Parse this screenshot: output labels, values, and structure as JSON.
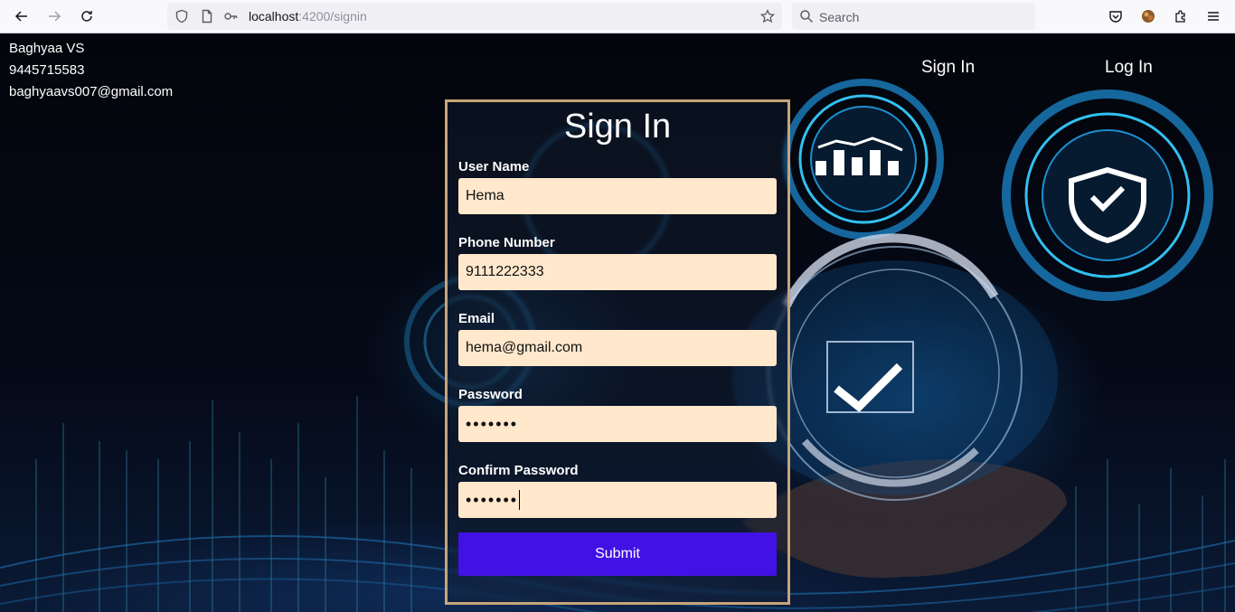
{
  "browser": {
    "url_host": "localhost",
    "url_path": ":4200/signin",
    "search_placeholder": "Search"
  },
  "profile": {
    "name": "Baghyaa VS",
    "phone": "9445715583",
    "email": "baghyaavs007@gmail.com"
  },
  "nav": {
    "signin_label": "Sign In",
    "login_label": "Log In"
  },
  "form": {
    "title": "Sign In",
    "username_label": "User Name",
    "username_value": "Hema",
    "phone_label": "Phone Number",
    "phone_value": "9111222333",
    "email_label": "Email",
    "email_value": "hema@gmail.com",
    "password_label": "Password",
    "password_mask": "•••••••",
    "confirm_label": "Confirm Password",
    "confirm_mask": "•••••••",
    "submit_label": "Submit"
  }
}
